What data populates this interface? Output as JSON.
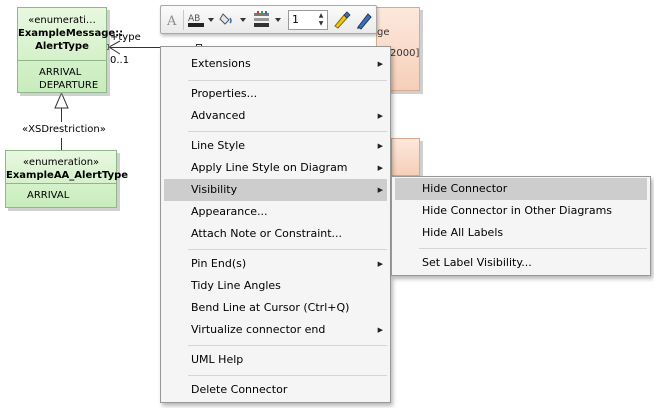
{
  "diagram": {
    "alert_type": {
      "stereotype": "«enumerati…",
      "name_line1": "ExampleMessage::",
      "name_line2": "AlertType",
      "attributes": [
        "ARRIVAL",
        "DEPARTURE"
      ]
    },
    "aa_alert_type": {
      "stereotype": "«enumeration»",
      "name": "ExampleAA_AlertType",
      "attributes": [
        "ARRIVAL"
      ]
    },
    "generalization_label": "«XSDrestriction»",
    "role_label": "+type",
    "multiplicity_label": "0..1",
    "background_texts": [
      "ge",
      "2000]"
    ]
  },
  "toolbar": {
    "line_width": "1",
    "icons": [
      "font-icon",
      "font-color-icon",
      "fill-color-icon",
      "line-color-icon",
      "line-width-spinner",
      "format-painter-icon",
      "pen-icon"
    ]
  },
  "context_menu": {
    "items": [
      {
        "label": "Extensions",
        "submenu": true
      },
      {
        "label": "Properties...",
        "submenu": false
      },
      {
        "label": "Advanced",
        "submenu": true
      },
      {
        "label": "Line Style",
        "submenu": true
      },
      {
        "label": "Apply Line Style on Diagram",
        "submenu": true
      },
      {
        "label": "Visibility",
        "submenu": true
      },
      {
        "label": "Appearance...",
        "submenu": false
      },
      {
        "label": "Attach Note or Constraint...",
        "submenu": false
      },
      {
        "label": "Pin End(s)",
        "submenu": true
      },
      {
        "label": "Tidy Line Angles",
        "submenu": false
      },
      {
        "label": "Bend Line at Cursor (Ctrl+Q)",
        "submenu": false
      },
      {
        "label": "Virtualize connector end",
        "submenu": true
      },
      {
        "label": "UML Help",
        "submenu": false
      },
      {
        "label": "Delete Connector",
        "submenu": false
      }
    ],
    "highlighted": "Visibility"
  },
  "visibility_submenu": {
    "items": [
      {
        "label": "Hide Connector"
      },
      {
        "label": "Hide Connector in Other Diagrams"
      },
      {
        "label": "Hide All Labels"
      },
      {
        "label": "Set Label Visibility..."
      }
    ],
    "highlighted": "Hide Connector"
  },
  "colors": {
    "class_fill_top": "#e8f8e0",
    "class_fill_bottom": "#c8ecbc",
    "class_border": "#8fb88a",
    "peach_fill": "#f6cfb9",
    "menu_background": "#f5f5f5",
    "menu_highlight": "#cdcdcd"
  }
}
